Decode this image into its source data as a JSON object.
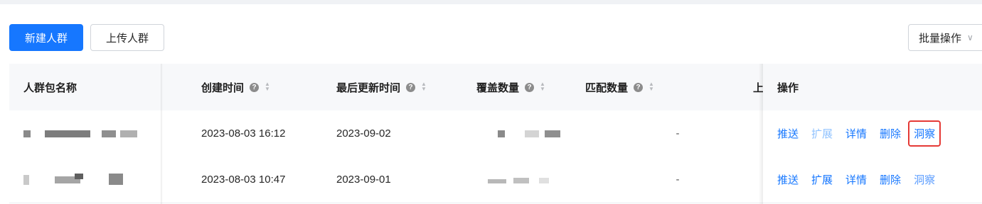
{
  "toolbar": {
    "new_group": "新建人群",
    "upload_group": "上传人群",
    "batch_ops": "批量操作"
  },
  "table": {
    "headers": {
      "name": "人群包名称",
      "created": "创建时间",
      "updated": "最后更新时间",
      "coverage": "覆盖数量",
      "match": "匹配数量",
      "upload_partial": "上",
      "actions": "操作"
    },
    "rows": [
      {
        "created": "2023-08-03 16:12",
        "updated": "2023-09-02",
        "match": "-",
        "actions": [
          "推送",
          "扩展",
          "详情",
          "删除",
          "洞察"
        ]
      },
      {
        "created": "2023-08-03 10:47",
        "updated": "2023-09-01",
        "match": "-",
        "actions": [
          "推送",
          "扩展",
          "详情",
          "删除",
          "洞察"
        ]
      }
    ]
  },
  "icons": {
    "help": "question-circle-icon",
    "sort": "sort-caret-icon",
    "dropdown": "chevron-down-icon"
  },
  "colors": {
    "primary": "#1677ff",
    "highlight_box": "#e53935"
  }
}
